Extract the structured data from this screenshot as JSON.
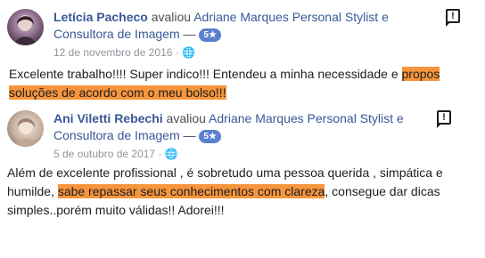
{
  "reviews": [
    {
      "author": "Letícia Pacheco",
      "action": " avaliou ",
      "page_line1": "Adriane Marques Personal Stylist e",
      "page_line2": "Consultora de Imagem",
      "separator": " — ",
      "rating": "5★",
      "date": "12 de novembro de 2016",
      "date_suffix": " · ",
      "text_before": "Excelente trabalho!!!! Super indico!!! Entendeu a minha necessidade e ",
      "text_highlight": "propos soluções de acordo com o meu bolso!!!",
      "text_after": "",
      "report_icon": "report-flag-icon"
    },
    {
      "author": "Ani Viletti Rebechi",
      "action": " avaliou ",
      "page_line1": "Adriane Marques Personal Stylist e",
      "page_line2": "Consultora de Imagem",
      "separator": " — ",
      "rating": "5★",
      "date": "5 de outubro de 2017",
      "date_suffix": " · ",
      "text_before": "Além de excelente profissional , é sobretudo uma pessoa querida , simpática e humilde, ",
      "text_highlight": "sabe repassar seus conhecimentos com clareza",
      "text_after": ", consegue dar dicas simples..porém muito válidas!! Adorei!!!",
      "report_icon": "report-flag-icon"
    }
  ],
  "colors": {
    "link": "#385898",
    "highlight": "#f7953c",
    "badge": "#5b7fd0",
    "meta": "#90949c"
  }
}
